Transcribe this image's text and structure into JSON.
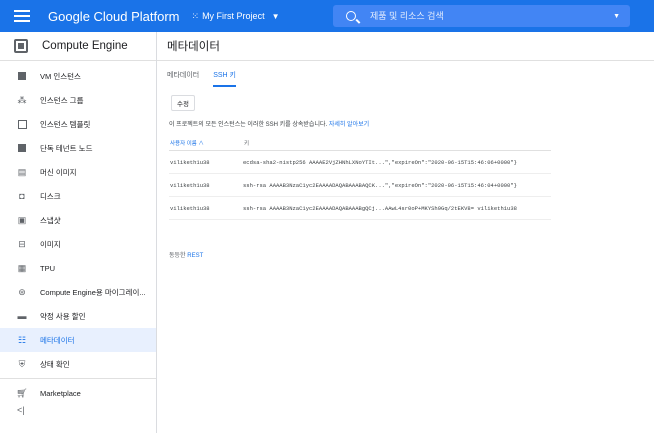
{
  "topbar": {
    "brand": "Google Cloud Platform",
    "project_dots": "⁙",
    "project": "My First Project",
    "search_placeholder": "제품 및 리소스 검색"
  },
  "sidebar": {
    "title": "Compute Engine",
    "items": [
      {
        "label": "VM 인스턴스",
        "icon": "vm-icon"
      },
      {
        "label": "인스턴스 그룹",
        "icon": "instance-group-icon"
      },
      {
        "label": "인스턴스 템플릿",
        "icon": "template-icon"
      },
      {
        "label": "단독 테넌트 노드",
        "icon": "sole-tenant-icon"
      },
      {
        "label": "머신 이미지",
        "icon": "machine-image-icon"
      },
      {
        "label": "디스크",
        "icon": "disk-icon"
      },
      {
        "label": "스냅샷",
        "icon": "snapshot-icon"
      },
      {
        "label": "이미지",
        "icon": "image-icon"
      },
      {
        "label": "TPU",
        "icon": "tpu-icon"
      },
      {
        "label": "Compute Engine용 마이그레이...",
        "icon": "migrate-icon"
      },
      {
        "label": "약정 사용 할인",
        "icon": "commitment-icon"
      },
      {
        "label": "메타데이터",
        "icon": "metadata-icon",
        "active": true
      },
      {
        "label": "상태 확인",
        "icon": "health-check-icon"
      },
      {
        "label": "Marketplace",
        "icon": "cart-icon"
      }
    ],
    "collapse": "<|"
  },
  "main": {
    "title": "메타데이터",
    "tabs": [
      "메타데이터",
      "SSH 키"
    ],
    "edit_label": "수정",
    "info_text": "이 프로젝트의 모든 인스턴스는 이러한 SSH 키를 상속받습니다.",
    "info_link": "자세히 알아보기",
    "columns": {
      "user": "사용자 이름",
      "sort_arrow": "∧",
      "key": "키"
    },
    "rows": [
      {
        "user": "viliketh1u38",
        "key": "ecdsa-sha2-nistp256 AAAAE2VjZHNhLXNoYTIt...\",\"expireOn\":\"2020-06-15T15:46:06+0000\"}"
      },
      {
        "user": "viliketh1u38",
        "key": "ssh-rsa AAAAB3NzaC1yc2EAAAADAQABAAABAQCK...\",\"expireOn\":\"2020-06-15T15:46:04+0000\"}"
      },
      {
        "user": "viliketh1u38",
        "key": "ssh-rsa AAAAB3NzaC1yc2EAAAADAQABAAABgQCj...AAwL4sr0oP+MKYSh9Gq/2tEKV8= viliketh1u38"
      }
    ],
    "equiv_prefix": "동등한",
    "equiv_link": "REST"
  },
  "colors": {
    "accent": "#1a73e8",
    "topbar": "#1a73e8",
    "search_bg": "#4285f4",
    "active_bg": "#e8f0fe"
  }
}
